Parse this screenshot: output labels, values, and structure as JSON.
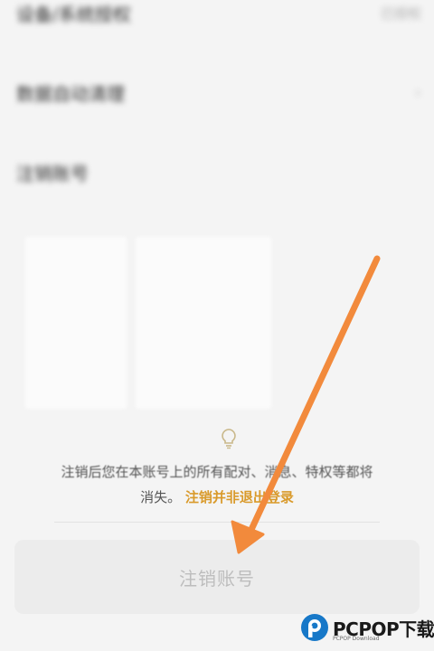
{
  "settings_list": {
    "items": [
      {
        "label": "设备/系统授权",
        "value": "已授权"
      },
      {
        "label": "数据自动清理"
      },
      {
        "label": "注销账号"
      }
    ]
  },
  "notice": {
    "line1": "注销后您在本账号上的所有配对、消息、特权等都将",
    "line2_prefix": "消失。",
    "line2_emphasis": "注销并非退出登录"
  },
  "deregister_button_label": "注销账号",
  "watermark": {
    "brand": "PCPOP下载",
    "subtitle": "PCPOP Download"
  },
  "colors": {
    "accent": "#d99a2b",
    "arrow": "#f28a3c",
    "button_bg": "#ececec",
    "logo_blue": "#1778c8"
  },
  "icons": {
    "bulb": "lightbulb-icon",
    "chevron": "chevron-right-icon",
    "arrow": "pointer-arrow-icon"
  }
}
